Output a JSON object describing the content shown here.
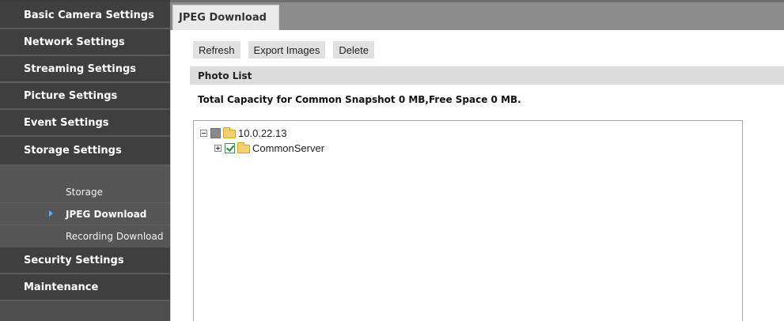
{
  "sidebar": {
    "items": [
      {
        "label": "Basic Camera Settings"
      },
      {
        "label": "Network Settings"
      },
      {
        "label": "Streaming Settings"
      },
      {
        "label": "Picture Settings"
      },
      {
        "label": "Event Settings"
      },
      {
        "label": "Storage Settings"
      }
    ],
    "storage_subitems": [
      {
        "label": "Storage"
      },
      {
        "label": "JPEG Download",
        "active": true
      },
      {
        "label": "Recording Download"
      }
    ],
    "items_after": [
      {
        "label": "Security Settings"
      },
      {
        "label": "Maintenance"
      }
    ]
  },
  "tabs": [
    {
      "label": "JPEG Download",
      "active": true
    }
  ],
  "toolbar": {
    "refresh_label": "Refresh",
    "export_label": "Export Images",
    "delete_label": "Delete"
  },
  "photo_list": {
    "header": "Photo List",
    "capacity_text": "Total Capacity for Common Snapshot 0 MB,Free Space 0 MB."
  },
  "tree": {
    "root": {
      "label": "10.0.22.13",
      "expanded": true,
      "check_state": "partial",
      "icon": "folder-icon"
    },
    "children": [
      {
        "label": "CommonServer",
        "expanded": false,
        "check_state": "checked",
        "icon": "folder-icon"
      }
    ]
  },
  "colors": {
    "sidebar_bg": "#3f3f3f",
    "submenu_bg": "#565656",
    "active_arrow": "#5ab4f0",
    "tabbar_bg": "#8c8c8c",
    "section_header_bg": "#dcdcdc",
    "button_bg": "#e1e1e1",
    "folder": "#f2d36b"
  }
}
